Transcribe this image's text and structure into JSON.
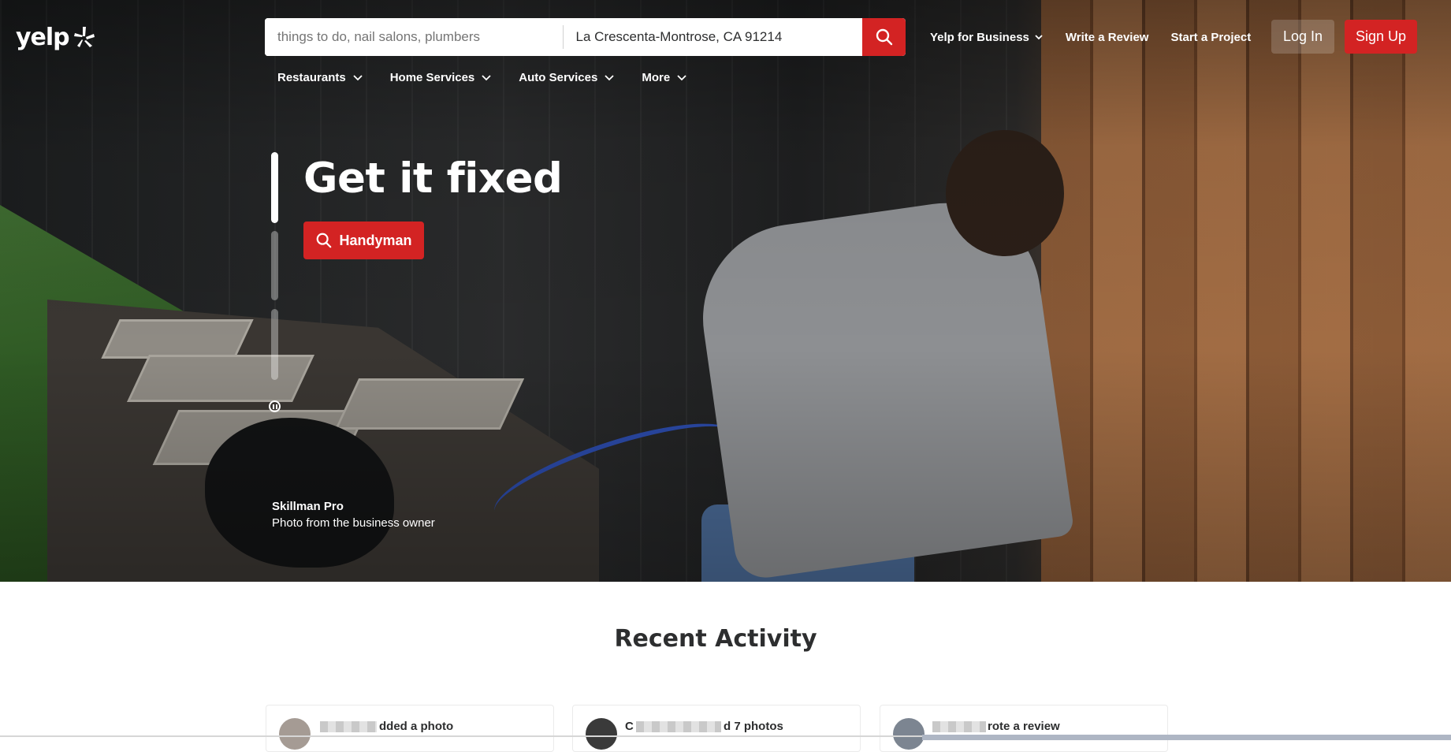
{
  "brand": {
    "logo_text": "yelp",
    "accent": "#d32323"
  },
  "search": {
    "find_placeholder": "things to do, nail salons, plumbers",
    "location_value": "La Crescenta-Montrose, CA 91214"
  },
  "top_nav": {
    "business": "Yelp for Business",
    "write_review": "Write a Review",
    "start_project": "Start a Project",
    "login": "Log In",
    "signup": "Sign Up"
  },
  "categories": [
    "Restaurants",
    "Home Services",
    "Auto Services",
    "More"
  ],
  "hero": {
    "title": "Get it fixed",
    "cta": "Handyman",
    "credit_name": "Skillman Pro",
    "credit_sub": "Photo from the business owner"
  },
  "recent_activity": {
    "title": "Recent Activity",
    "cards": [
      {
        "text": "dded a photo"
      },
      {
        "prefix": "C",
        "text": "d 7 photos"
      },
      {
        "text": "rote a review"
      }
    ]
  }
}
